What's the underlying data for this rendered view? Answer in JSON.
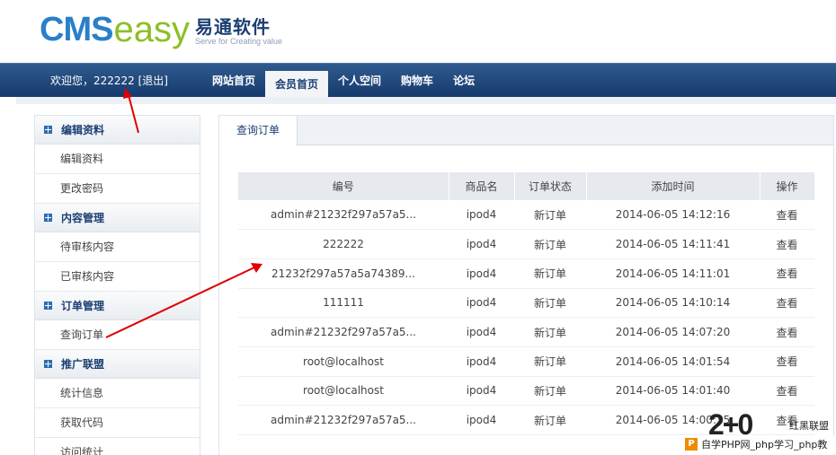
{
  "brand": {
    "logo_cms": "CMS",
    "logo_easy": "easy",
    "logo_cn": "易通软件",
    "tagline": "Serve for Creating value"
  },
  "header": {
    "welcome": "欢迎您，222222 [退出]",
    "nav": [
      "网站首页",
      "会员首页",
      "个人空间",
      "购物车",
      "论坛"
    ],
    "active_nav": "会员首页"
  },
  "sidebar": {
    "groups": [
      {
        "title": "编辑资料",
        "items": [
          "编辑资料",
          "更改密码"
        ]
      },
      {
        "title": "内容管理",
        "items": [
          "待审核内容",
          "已审核内容"
        ]
      },
      {
        "title": "订单管理",
        "items": [
          "查询订单"
        ]
      },
      {
        "title": "推广联盟",
        "items": [
          "统计信息",
          "获取代码",
          "访问统计"
        ]
      }
    ]
  },
  "main": {
    "tab": "查询订单",
    "columns": [
      "编号",
      "商品名",
      "订单状态",
      "添加时间",
      "操作"
    ],
    "rows": [
      {
        "id": "admin#21232f297a57a5...",
        "product": "ipod4",
        "status": "新订单",
        "time": "2014-06-05 14:12:16",
        "action": "查看"
      },
      {
        "id": "222222",
        "product": "ipod4",
        "status": "新订单",
        "time": "2014-06-05 14:11:41",
        "action": "查看"
      },
      {
        "id": "21232f297a57a5a74389...",
        "product": "ipod4",
        "status": "新订单",
        "time": "2014-06-05 14:11:01",
        "action": "查看"
      },
      {
        "id": "111111",
        "product": "ipod4",
        "status": "新订单",
        "time": "2014-06-05 14:10:14",
        "action": "查看"
      },
      {
        "id": "admin#21232f297a57a5...",
        "product": "ipod4",
        "status": "新订单",
        "time": "2014-06-05 14:07:20",
        "action": "查看"
      },
      {
        "id": "root@localhost",
        "product": "ipod4",
        "status": "新订单",
        "time": "2014-06-05 14:01:54",
        "action": "查看"
      },
      {
        "id": "root@localhost",
        "product": "ipod4",
        "status": "新订单",
        "time": "2014-06-05 14:01:40",
        "action": "查看"
      },
      {
        "id": "admin#21232f297a57a5...",
        "product": "ipod4",
        "status": "新订单",
        "time": "2014-06-05 14:00:35",
        "action": "查看"
      }
    ]
  },
  "watermark": {
    "big": "2+0",
    "red": "红黑联盟",
    "bar": "自学PHP网_php学习_php教"
  },
  "colors": {
    "nav_bg": "#1b3f73",
    "status_red": "#d40000",
    "accent_blue": "#2a7fc8",
    "logo_green": "#8cbf26",
    "arrow_red": "#e00000"
  }
}
